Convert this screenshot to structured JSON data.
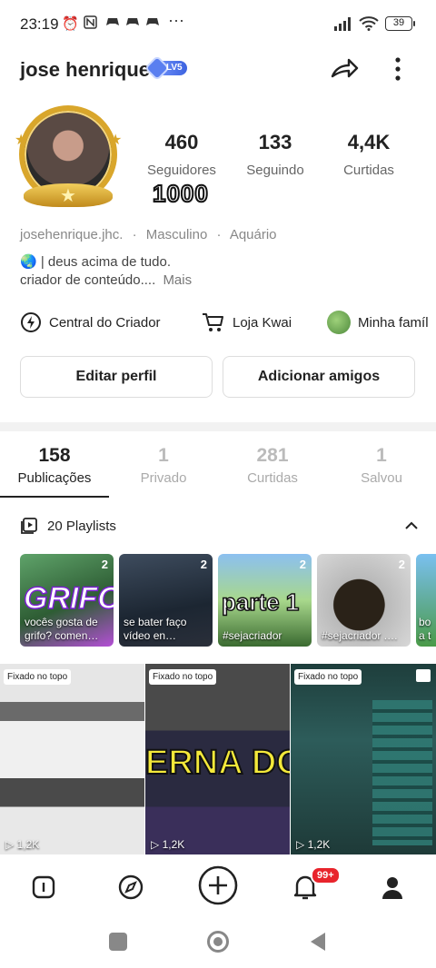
{
  "status_bar": {
    "time": "23:19",
    "icons": [
      "alarm-icon",
      "nfc-icon",
      "game-icon",
      "game-icon",
      "game-icon",
      "more-icon"
    ],
    "more": "···",
    "battery": "39"
  },
  "header": {
    "username": "jose henrique",
    "level": "LV5"
  },
  "stats": [
    {
      "value": "460",
      "label": "Seguidores"
    },
    {
      "value": "133",
      "label": "Seguindo"
    },
    {
      "value": "4,4K",
      "label": "Curtidas"
    }
  ],
  "follower_badge": "1000",
  "profile": {
    "handle": "josehenrique.jhc.",
    "gender": "Masculino",
    "sign": "Aquário",
    "sep": "·",
    "bio_line1": "🌏 | deus acima de tudo.",
    "bio_line2": "criador de conteúdo....",
    "more": "Mais"
  },
  "quick_links": [
    {
      "label": "Central do Criador",
      "icon": "lightning-icon"
    },
    {
      "label": "Loja Kwai",
      "icon": "cart-icon"
    },
    {
      "label": "Minha famíl",
      "icon": "family-avatar-icon"
    }
  ],
  "buttons": {
    "edit": "Editar perfil",
    "add": "Adicionar amigos"
  },
  "tabs": [
    {
      "count": "158",
      "label": "Publicações",
      "active": true
    },
    {
      "count": "1",
      "label": "Privado",
      "active": false
    },
    {
      "count": "281",
      "label": "Curtidas",
      "active": false
    },
    {
      "count": "1",
      "label": "Salvou",
      "active": false
    }
  ],
  "playlists": {
    "title": "20 Playlists",
    "items": [
      {
        "count": "2",
        "caption": "vocês gosta de grifo? comen…",
        "overlay": "GRIFO",
        "color1": "#4a9a5a",
        "color2": "#c050e0"
      },
      {
        "count": "2",
        "caption": "se bater faço vídeo en…",
        "overlay": "",
        "color1": "#2a3848",
        "color2": "#1a2430"
      },
      {
        "count": "2",
        "caption": "#sejacriador",
        "overlay": "parte 1",
        "color1": "#7ab0e8",
        "color2": "#3e7a3a"
      },
      {
        "count": "2",
        "caption": "#sejacriador .…",
        "overlay": "",
        "color1": "#c8c8c8",
        "color2": "#3a3020"
      },
      {
        "count": "",
        "caption": "bo a t",
        "overlay": "",
        "color1": "#6ab4e8",
        "color2": "#3a8a3a"
      }
    ]
  },
  "videos": [
    {
      "pinned": "Fixado no topo",
      "views": "1,2K",
      "color1": "#d8d8d8",
      "color2": "#555"
    },
    {
      "pinned": "Fixado no topo",
      "views": "1,2K",
      "overlay": "ERNA DO",
      "color1": "#3a3a3a",
      "color2": "#1c1c3a"
    },
    {
      "pinned": "Fixado no topo",
      "views": "1,2K",
      "color1": "#1c3c3a",
      "color2": "#2c5a58"
    }
  ],
  "bottom_nav": {
    "items": [
      "home-icon",
      "discover-icon",
      "create-icon",
      "notifications-icon",
      "profile-icon"
    ],
    "notif_badge": "99+"
  },
  "system_nav": [
    "recents-icon",
    "home-circle-icon",
    "back-icon"
  ]
}
